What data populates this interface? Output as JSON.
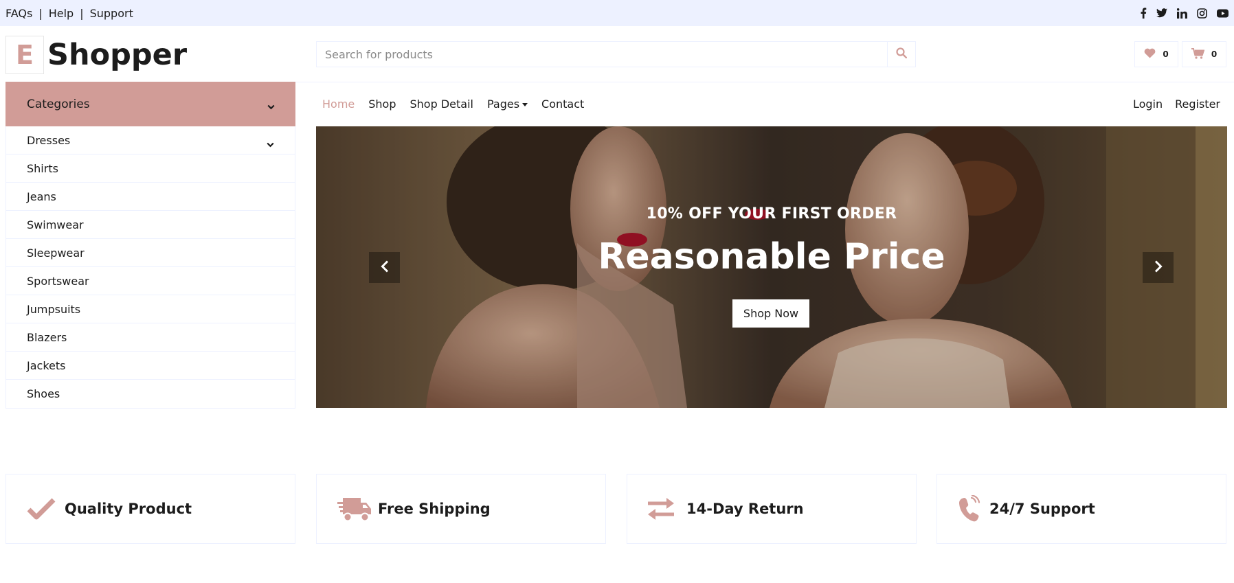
{
  "topbar": {
    "links": [
      "FAQs",
      "Help",
      "Support"
    ],
    "separator": "|",
    "social": [
      "facebook-icon",
      "twitter-icon",
      "linkedin-icon",
      "instagram-icon",
      "youtube-icon"
    ]
  },
  "header": {
    "logo_letter": "E",
    "logo_text": "Shopper",
    "search_placeholder": "Search for products",
    "wishlist_count": "0",
    "cart_count": "0"
  },
  "categories": {
    "title": "Categories",
    "items": [
      {
        "label": "Dresses",
        "has_submenu": true
      },
      {
        "label": "Shirts"
      },
      {
        "label": "Jeans"
      },
      {
        "label": "Swimwear"
      },
      {
        "label": "Sleepwear"
      },
      {
        "label": "Sportswear"
      },
      {
        "label": "Jumpsuits"
      },
      {
        "label": "Blazers"
      },
      {
        "label": "Jackets"
      },
      {
        "label": "Shoes"
      }
    ]
  },
  "nav": {
    "items": [
      "Home",
      "Shop",
      "Shop Detail",
      "Pages",
      "Contact"
    ],
    "active": "Home",
    "right": [
      "Login",
      "Register"
    ]
  },
  "hero": {
    "subtitle": "10% OFF YOUR FIRST ORDER",
    "title": "Reasonable Price",
    "button": "Shop Now"
  },
  "features": [
    {
      "icon": "check-icon",
      "label": "Quality Product"
    },
    {
      "icon": "truck-icon",
      "label": "Free Shipping"
    },
    {
      "icon": "exchange-icon",
      "label": "14-Day Return"
    },
    {
      "icon": "phone-icon",
      "label": "24/7 Support"
    }
  ],
  "colors": {
    "accent": "#d19c97",
    "topbar_bg": "#edf1ff",
    "border": "#edf1ff",
    "text": "#1c1c1c"
  }
}
